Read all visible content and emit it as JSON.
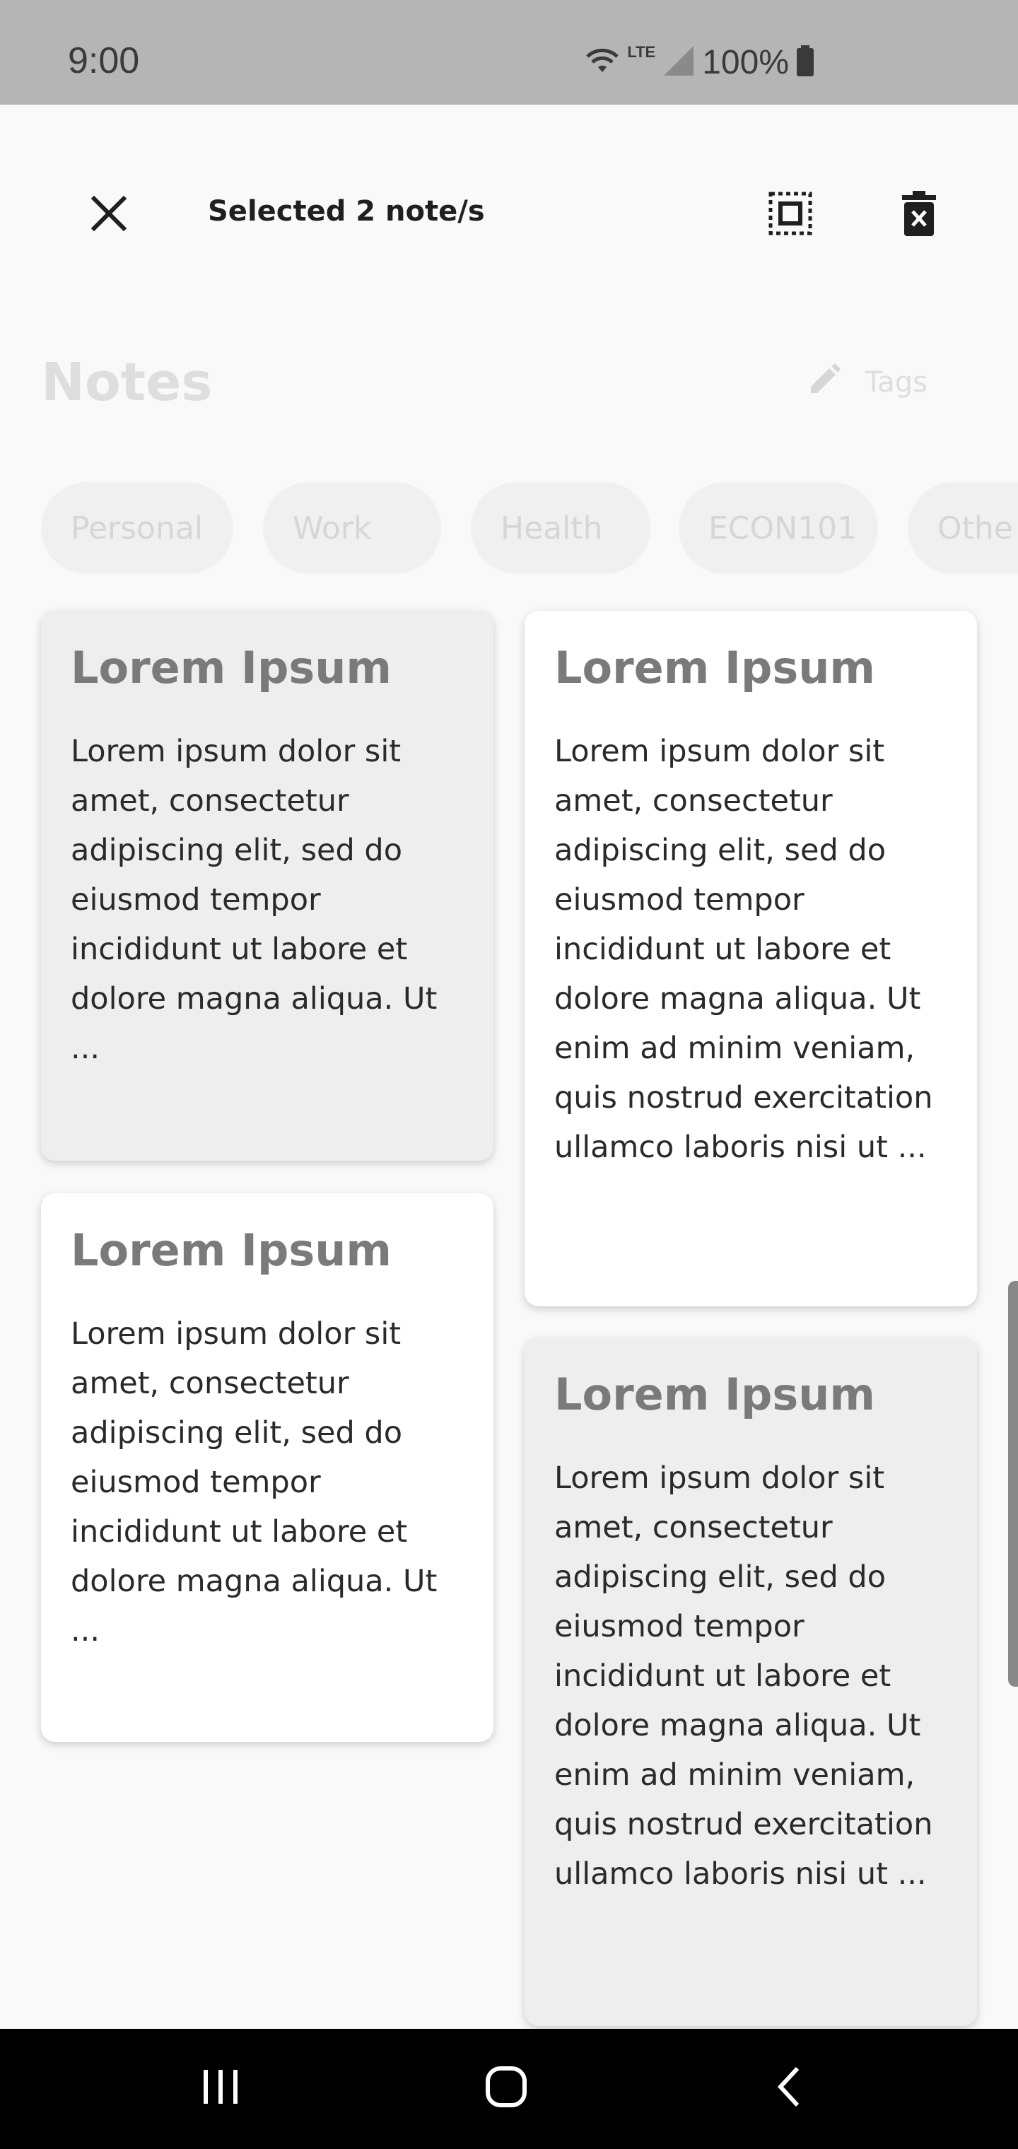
{
  "status_bar": {
    "time": "9:00",
    "network": "LTE",
    "battery": "100%"
  },
  "selection_bar": {
    "title": "Selected 2 note/s"
  },
  "page": {
    "heading": "Notes",
    "tags_label": "Tags"
  },
  "tag_chips": [
    "Personal",
    "Work",
    "Health",
    "ECON101",
    "Othe"
  ],
  "notes": [
    {
      "title": "Lorem Ipsum",
      "body": "Lorem ipsum dolor sit amet, consectetur adipiscing elit, sed do eiusmod tempor incididunt ut labore et dolore magna aliqua. Ut ...",
      "selected": true
    },
    {
      "title": "Lorem Ipsum",
      "body": "Lorem ipsum dolor sit amet, consectetur adipiscing elit, sed do eiusmod tempor incididunt ut labore et dolore magna aliqua. Ut enim ad minim veniam, quis nostrud exercitation ullamco laboris nisi ut ...",
      "selected": false
    },
    {
      "title": "Lorem Ipsum",
      "body": "Lorem ipsum dolor sit amet, consectetur adipiscing elit, sed do eiusmod tempor incididunt ut labore et dolore magna aliqua. Ut ...",
      "selected": false
    },
    {
      "title": "Lorem Ipsum",
      "body": "Lorem ipsum dolor sit amet, consectetur adipiscing elit, sed do eiusmod tempor incididunt ut labore et dolore magna aliqua. Ut enim ad minim veniam, quis nostrud exercitation ullamco laboris nisi ut ...",
      "selected": true
    }
  ],
  "icons": {
    "close": "close-icon",
    "select_all": "select-all-icon",
    "delete": "delete-icon",
    "edit": "pencil-icon"
  },
  "colors": {
    "selected_card": "#eeeeee",
    "card": "#ffffff",
    "background": "#f9f9f9"
  }
}
